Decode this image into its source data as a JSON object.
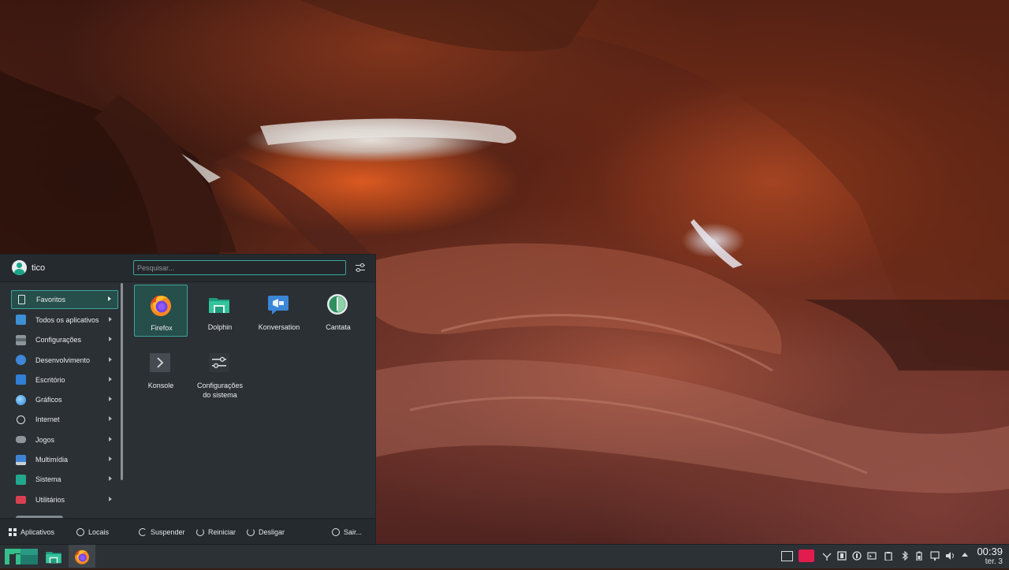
{
  "launcher": {
    "username": "tico",
    "search_placeholder": "Pesquisar...",
    "categories": [
      {
        "label": "Favoritos",
        "icon": "bookmark-icon",
        "color": "#3aa59a",
        "active": true
      },
      {
        "label": "Todos os aplicativos",
        "icon": "apps-grid-icon",
        "color": "#3d8fd6"
      },
      {
        "label": "Configurações",
        "icon": "settings-icon",
        "color": "#6f7a80"
      },
      {
        "label": "Desenvolvimento",
        "icon": "development-icon",
        "color": "#3f87d8"
      },
      {
        "label": "Escritório",
        "icon": "office-icon",
        "color": "#2f7fd6"
      },
      {
        "label": "Gráficos",
        "icon": "graphics-icon",
        "color": "#4aa6e8"
      },
      {
        "label": "Internet",
        "icon": "globe-icon",
        "color": "#dfe4e6"
      },
      {
        "label": "Jogos",
        "icon": "gamepad-icon",
        "color": "#8d969a"
      },
      {
        "label": "Multimídia",
        "icon": "multimedia-icon",
        "color": "#3f84d4"
      },
      {
        "label": "Sistema",
        "icon": "system-icon",
        "color": "#22a88c"
      },
      {
        "label": "Utilitários",
        "icon": "toolbox-icon",
        "color": "#d8404f"
      }
    ],
    "favorites": [
      {
        "label": "Firefox",
        "icon": "firefox-icon",
        "selected": true
      },
      {
        "label": "Dolphin",
        "icon": "dolphin-folder-icon"
      },
      {
        "label": "Konversation",
        "icon": "konversation-icon"
      },
      {
        "label": "Cantata",
        "icon": "cantata-icon"
      },
      {
        "label": "Konsole",
        "icon": "konsole-icon"
      },
      {
        "label": "Configurações\ndo sistema",
        "icon": "system-settings-icon"
      }
    ],
    "footer": {
      "apps_tab": "Aplicativos",
      "places_tab": "Locais",
      "suspend": "Suspender",
      "restart": "Reiniciar",
      "shutdown": "Desligar",
      "logout": "Sair..."
    }
  },
  "taskbar": {
    "clock_time": "00:39",
    "clock_date": "ter. 3"
  },
  "colors": {
    "accent": "#3aa59a",
    "panel": "#2b3035",
    "taskbar": "#2c3136"
  }
}
